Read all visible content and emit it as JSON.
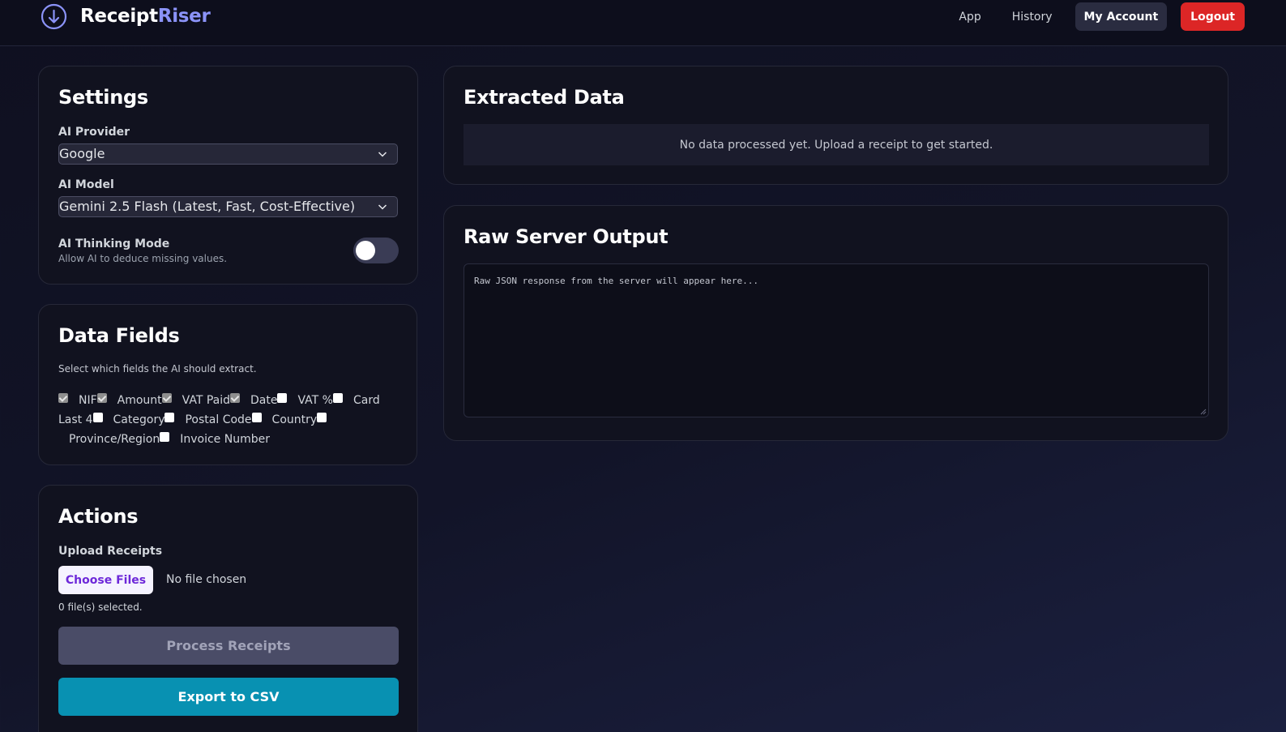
{
  "header": {
    "brand_part1": "Receipt",
    "brand_part2": "Riser",
    "nav": {
      "app": "App",
      "history": "History",
      "account": "My Account",
      "logout": "Logout"
    }
  },
  "settings": {
    "title": "Settings",
    "provider_label": "AI Provider",
    "provider_value": "Google",
    "model_label": "AI Model",
    "model_value": "Gemini 2.5 Flash (Latest, Fast, Cost-Effective)",
    "thinking_label": "AI Thinking Mode",
    "thinking_hint": "Allow AI to deduce missing values.",
    "thinking_enabled": false
  },
  "data_fields": {
    "title": "Data Fields",
    "hint": "Select which fields the AI should extract.",
    "fields": [
      {
        "label": "NIF",
        "checked": true
      },
      {
        "label": "Amount",
        "checked": true
      },
      {
        "label": "VAT Paid",
        "checked": true
      },
      {
        "label": "Date",
        "checked": true
      },
      {
        "label": "VAT %",
        "checked": false
      },
      {
        "label": "Card Last 4",
        "checked": false
      },
      {
        "label": "Category",
        "checked": false
      },
      {
        "label": "Postal Code",
        "checked": false
      },
      {
        "label": "Country",
        "checked": false
      },
      {
        "label": "Province/Region",
        "checked": false
      },
      {
        "label": "Invoice Number",
        "checked": false
      }
    ]
  },
  "actions": {
    "title": "Actions",
    "upload_label": "Upload Receipts",
    "choose_label": "Choose Files",
    "no_file": "No file chosen",
    "selected_count": "0 file(s) selected.",
    "process_label": "Process Receipts",
    "export_label": "Export to CSV"
  },
  "extracted": {
    "title": "Extracted Data",
    "empty_text": "No data processed yet. Upload a receipt to get started."
  },
  "raw": {
    "title": "Raw Server Output",
    "placeholder": "Raw JSON response from the server will appear here..."
  },
  "colors": {
    "accent": "#8b93f8",
    "logout": "#dc2626",
    "export": "#0891b2",
    "process_disabled": "#4a4c67"
  }
}
